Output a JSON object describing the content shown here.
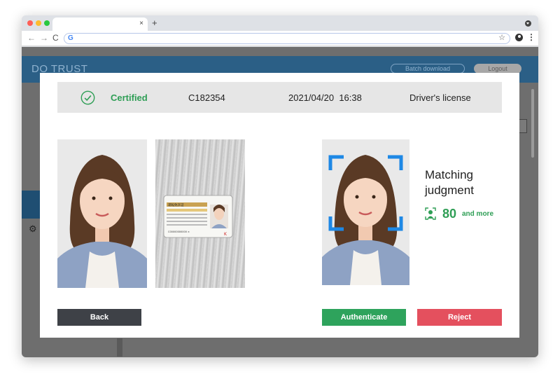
{
  "browser": {
    "tab_close": "×",
    "new_tab": "+",
    "back": "←",
    "forward": "→",
    "reload": "C",
    "omnibox_icon": "G",
    "bookmark_star": "☆",
    "menu": "⋮"
  },
  "app": {
    "brand": "DO TRUST",
    "batch_download": "Batch download",
    "logout": "Logout"
  },
  "certificate": {
    "status": "Certified",
    "id": "C182354",
    "date": "2021/04/20",
    "time": "16:38",
    "document_type": "Driver's license"
  },
  "matching": {
    "title": "Matching judgment",
    "score": "80",
    "score_suffix": "and more"
  },
  "buttons": {
    "back": "Back",
    "authenticate": "Authenticate",
    "reject": "Reject"
  },
  "license_card": {
    "header": "運転免許証",
    "number": "C00000000000 ×"
  },
  "colors": {
    "accent_green": "#2e9e55",
    "reject_red": "#e4505e",
    "header_blue": "#2b5f86",
    "dark_button": "#3e4147"
  }
}
